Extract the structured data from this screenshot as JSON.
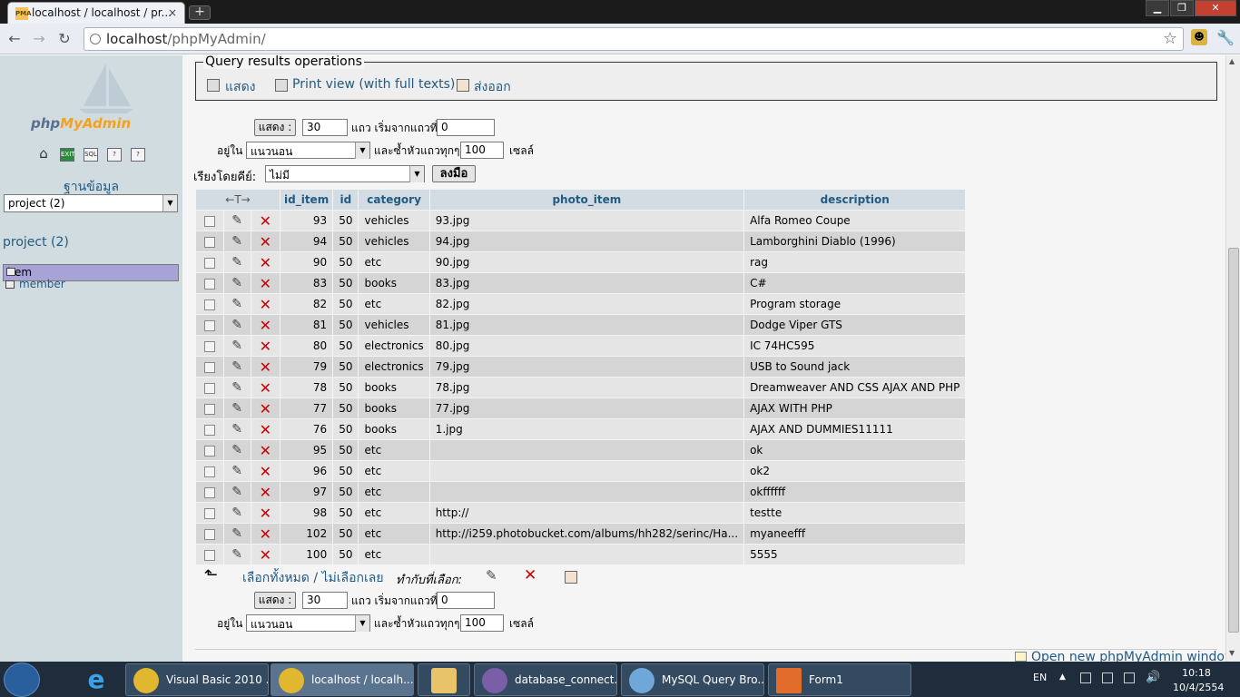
{
  "browser": {
    "tab_title": "localhost / localhost / pr...",
    "tab_favicon": "PMA",
    "tab_close": "×",
    "new_tab": "+",
    "url_host": "localhost",
    "url_path": "/phpMyAdmin/",
    "window_buttons": [
      "▁",
      "❐",
      "✕"
    ]
  },
  "nav": {
    "logo_a": "php",
    "logo_b": "MyAdmin",
    "icons": [
      "home-icon",
      "exit-icon",
      "sql-icon",
      "query-icon",
      "docs-icon"
    ],
    "icon_labels": [
      "⌂",
      "EXIT",
      "SQL",
      "?",
      "?"
    ],
    "db_label": "ฐานข้อมูล",
    "db_selected": "project (2)",
    "db_name": "project (2)",
    "tables": [
      "item",
      "member"
    ]
  },
  "main": {
    "legend": "Query results operations",
    "op_show": "แสดง",
    "op_print": "Print view (with full texts)",
    "op_export": "ส่งออก",
    "show_btn": "แสดง :",
    "rows_value": "30",
    "rows_label": "แถว เริ่มจากแถวที่",
    "start_value": "0",
    "mode_label": "อยู่ใน",
    "mode_value": "แนวนอน",
    "repeat_label": "และซ้ำหัวแถวทุกๆ",
    "repeat_value": "100",
    "cells_label": "เซลล์",
    "sort_label": "เรียงโดยคีย์:",
    "sort_value": "ไม่มี",
    "go_btn": "ลงมือ",
    "arrows": "←T→",
    "columns": [
      "id_item",
      "id",
      "category",
      "photo_item",
      "description"
    ],
    "rows": [
      {
        "id_item": "93",
        "id": "50",
        "category": "vehicles",
        "photo_item": "93.jpg",
        "description": "Alfa Romeo Coupe"
      },
      {
        "id_item": "94",
        "id": "50",
        "category": "vehicles",
        "photo_item": "94.jpg",
        "description": "Lamborghini Diablo (1996)"
      },
      {
        "id_item": "90",
        "id": "50",
        "category": "etc",
        "photo_item": "90.jpg",
        "description": "rag"
      },
      {
        "id_item": "83",
        "id": "50",
        "category": "books",
        "photo_item": "83.jpg",
        "description": "C#"
      },
      {
        "id_item": "82",
        "id": "50",
        "category": "etc",
        "photo_item": "82.jpg",
        "description": "Program storage"
      },
      {
        "id_item": "81",
        "id": "50",
        "category": "vehicles",
        "photo_item": "81.jpg",
        "description": "Dodge Viper GTS"
      },
      {
        "id_item": "80",
        "id": "50",
        "category": "electronics",
        "photo_item": "80.jpg",
        "description": "IC 74HC595"
      },
      {
        "id_item": "79",
        "id": "50",
        "category": "electronics",
        "photo_item": "79.jpg",
        "description": "USB to Sound jack"
      },
      {
        "id_item": "78",
        "id": "50",
        "category": "books",
        "photo_item": "78.jpg",
        "description": "Dreamweaver AND CSS AJAX AND PHP"
      },
      {
        "id_item": "77",
        "id": "50",
        "category": "books",
        "photo_item": "77.jpg",
        "description": "AJAX WITH PHP"
      },
      {
        "id_item": "76",
        "id": "50",
        "category": "books",
        "photo_item": "1.jpg",
        "description": "AJAX AND DUMMIES11111"
      },
      {
        "id_item": "95",
        "id": "50",
        "category": "etc",
        "photo_item": "",
        "description": "ok"
      },
      {
        "id_item": "96",
        "id": "50",
        "category": "etc",
        "photo_item": "",
        "description": "ok2"
      },
      {
        "id_item": "97",
        "id": "50",
        "category": "etc",
        "photo_item": "",
        "description": "okffffff"
      },
      {
        "id_item": "98",
        "id": "50",
        "category": "etc",
        "photo_item": "http://",
        "description": "testte"
      },
      {
        "id_item": "102",
        "id": "50",
        "category": "etc",
        "photo_item": "http://i259.photobucket.com/albums/hh282/serinc/Ha...",
        "description": "myaneefff"
      },
      {
        "id_item": "100",
        "id": "50",
        "category": "etc",
        "photo_item": "",
        "description": "5555"
      }
    ],
    "check_all": "เลือกทั้งหมด / ไม่เลือกเลย",
    "with_selected": "ทำกับที่เลือก:",
    "open_new": "Open new phpMyAdmin window"
  },
  "taskbar": {
    "items": [
      "Visual Basic 2010 ...",
      "localhost / localh...",
      "",
      "database_connect...",
      "MySQL Query Bro...",
      "Form1"
    ],
    "lang": "EN",
    "time": "10:18",
    "date": "10/4/2554"
  }
}
